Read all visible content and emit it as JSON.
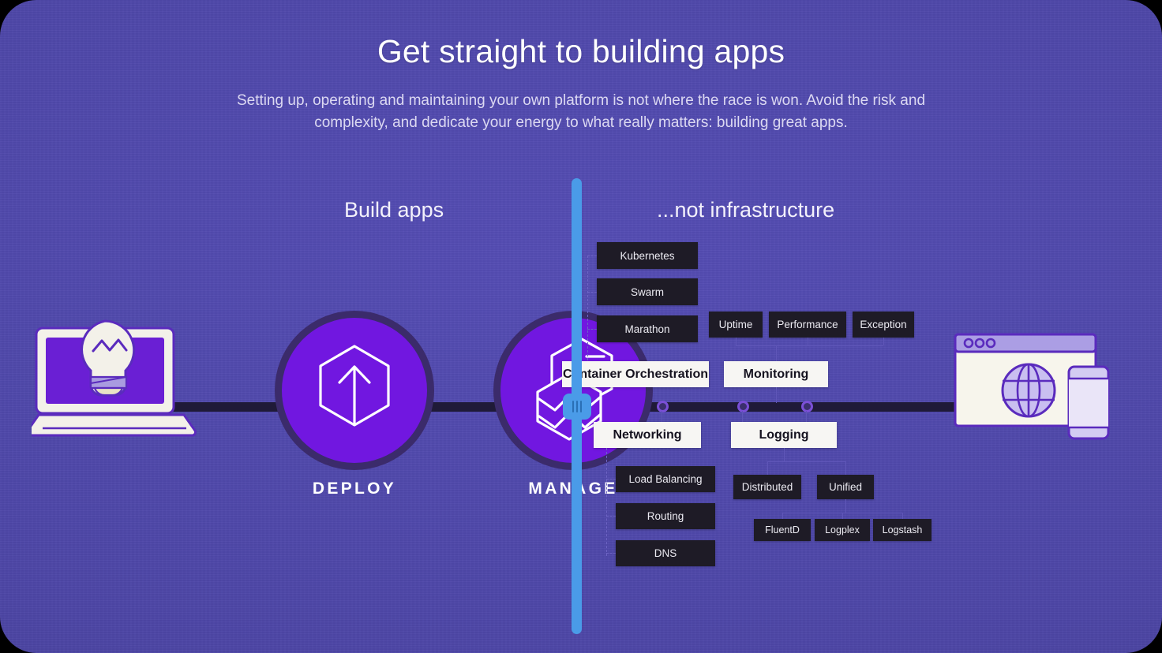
{
  "header": {
    "title": "Get straight to building apps",
    "subtitle": "Setting up, operating and maintaining your own platform is not where the race is won. Avoid the risk and complexity, and dedicate your energy to what really matters: building great apps."
  },
  "columns": {
    "left_heading": "Build apps",
    "right_heading": "...not infrastructure"
  },
  "pipeline": {
    "source_icon": "laptop-lightbulb-icon",
    "stages": [
      {
        "id": "deploy",
        "label": "DEPLOY",
        "icon": "hexagon-up-arrow-icon"
      },
      {
        "id": "manage",
        "label": "MANAGE",
        "icon": "stacked-hexagons-icon"
      }
    ],
    "target_icon": "browser-devices-icon"
  },
  "divider": {
    "name": "comparison-slider",
    "handle_icon": "grip-handle-icon",
    "color": "#4a9be8"
  },
  "infrastructure": {
    "rail_nodes": 3,
    "categories": [
      {
        "id": "container-orchestration",
        "label": "Container Orchestration",
        "children": [
          "Kubernetes",
          "Swarm",
          "Marathon"
        ]
      },
      {
        "id": "monitoring",
        "label": "Monitoring",
        "children": [
          "Uptime",
          "Performance",
          "Exception"
        ]
      },
      {
        "id": "networking",
        "label": "Networking",
        "children": [
          "Load Balancing",
          "Routing",
          "DNS"
        ]
      },
      {
        "id": "logging",
        "label": "Logging",
        "children": [
          "Distributed",
          "Unified"
        ],
        "grandchildren": [
          "FluentD",
          "Logplex",
          "Logstash"
        ]
      }
    ]
  },
  "colors": {
    "background": "#514aab",
    "accent_purple": "#7117e0",
    "accent_blue": "#4a9be8",
    "rail_dark": "#1f1a38",
    "node_dark": "#1e1b26",
    "node_light": "#f7f6f3"
  }
}
